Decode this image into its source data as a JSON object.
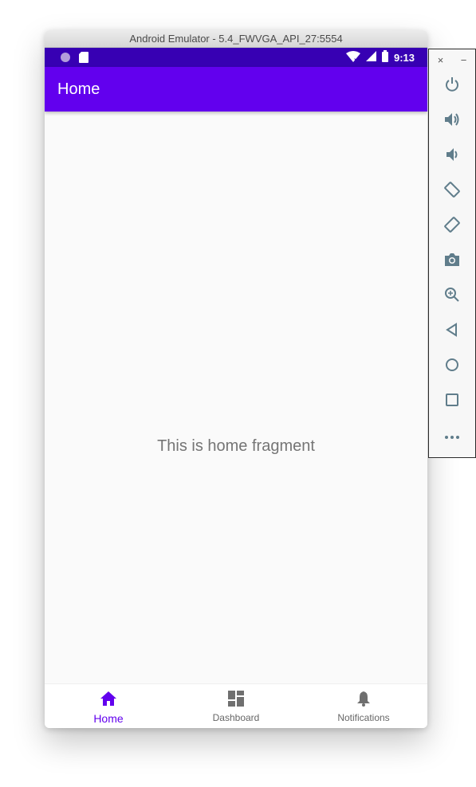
{
  "window": {
    "title": "Android Emulator - 5.4_FWVGA_API_27:5554"
  },
  "status_bar": {
    "time": "9:13",
    "icons": [
      "notification-dot-icon",
      "sd-card-icon",
      "wifi-icon",
      "signal-icon",
      "battery-icon"
    ],
    "background": "#3700b3"
  },
  "app_bar": {
    "title": "Home",
    "background": "#6200ee"
  },
  "content": {
    "text": "This is home fragment"
  },
  "bottom_nav": {
    "items": [
      {
        "label": "Home",
        "icon": "home-icon",
        "active": true
      },
      {
        "label": "Dashboard",
        "icon": "dashboard-icon",
        "active": false
      },
      {
        "label": "Notifications",
        "icon": "bell-icon",
        "active": false
      }
    ],
    "active_color": "#6200ee",
    "inactive_color": "#666666"
  },
  "side_toolbar": {
    "top": {
      "close": "×",
      "minimize": "−"
    },
    "buttons": [
      "power-icon",
      "volume-up-icon",
      "volume-down-icon",
      "rotate-left-icon",
      "rotate-right-icon",
      "camera-icon",
      "zoom-icon",
      "back-icon",
      "home-circle-icon",
      "overview-icon",
      "more-icon"
    ],
    "icon_color": "#607d8b"
  }
}
